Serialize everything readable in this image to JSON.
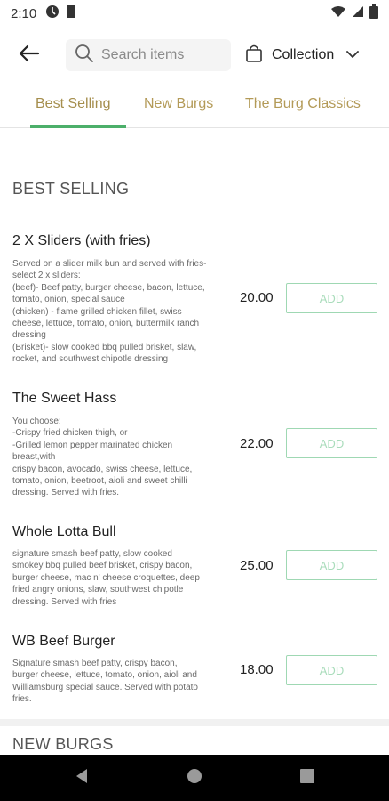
{
  "status_bar": {
    "time": "2:10",
    "left_icons": [
      "settings-gear-icon",
      "sd-card-icon"
    ],
    "right_icons": [
      "wifi-icon",
      "cellular-signal-icon",
      "battery-icon"
    ]
  },
  "header": {
    "back_icon": "arrow-left-icon",
    "search": {
      "placeholder": "Search items",
      "value": ""
    },
    "collection_label": "Collection"
  },
  "tabs": [
    {
      "label": "Best Selling",
      "active": true
    },
    {
      "label": "New Burgs",
      "active": false
    },
    {
      "label": "The Burg Classics",
      "active": false
    }
  ],
  "sections": {
    "best_selling_title": "BEST SELLING",
    "new_burgs_title": "NEW BURGS"
  },
  "items": [
    {
      "name": "2 X Sliders (with fries)",
      "description": "Served on a slider milk bun and served with fries-\nselect 2 x sliders:\n (beef)- Beef patty, burger cheese, bacon, lettuce,\ntomato, onion, special sauce\n (chicken) - flame grilled chicken fillet, swiss\ncheese, lettuce, tomato, onion, buttermilk ranch\ndressing\n (Brisket)- slow cooked bbq pulled brisket, slaw,\nrocket,  and southwest chipotle dressing",
      "price": "20.00",
      "add_label": "ADD"
    },
    {
      "name": "The Sweet Hass",
      "description": "You choose:\n-Crispy fried chicken thigh, or\n-Grilled lemon pepper marinated chicken\nbreast,with\ncrispy bacon, avocado, swiss cheese, lettuce,\ntomato, onion, beetroot, aioli and sweet chilli\ndressing. Served with fries.",
      "price": "22.00",
      "add_label": "ADD"
    },
    {
      "name": "Whole Lotta Bull",
      "description": "signature smash beef patty, slow cooked\nsmokey bbq pulled beef brisket, crispy bacon,\nburger cheese, mac n' cheese croquettes, deep\nfried angry onions, slaw, southwest chipotle\ndressing. Served with fries",
      "price": "25.00",
      "add_label": "ADD"
    },
    {
      "name": "WB Beef Burger",
      "description": "Signature smash beef patty, crispy bacon,\nburger cheese, lettuce, tomato, onion, aioli and\nWilliamsburg special sauce. Served with potato\nfries.",
      "price": "18.00",
      "add_label": "ADD"
    }
  ],
  "nav_bar": {
    "icons": [
      "back-triangle-icon",
      "home-circle-icon",
      "recents-square-icon"
    ]
  },
  "colors": {
    "accent_green": "#4caf6a",
    "tab_text": "#b39a57",
    "add_border": "#9fd8b3"
  }
}
